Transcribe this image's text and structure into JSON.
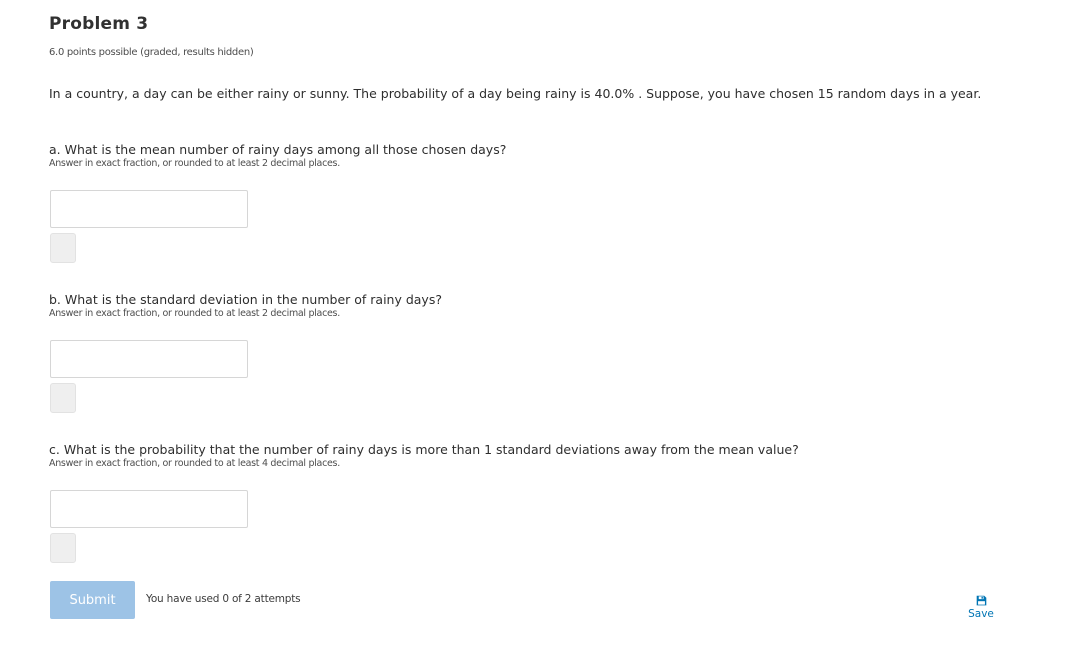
{
  "problem": {
    "title": "Problem 3",
    "points": "6.0 points possible (graded, results hidden)",
    "prompt": "In a country, a day can be either rainy or sunny. The probability of a day being rainy is 40.0% . Suppose, you have chosen 15 random days in a year."
  },
  "questions": [
    {
      "text": "a. What is the mean number of rainy days among all those chosen days?",
      "hint": "Answer in exact fraction, or rounded to at least 2 decimal places.",
      "value": ""
    },
    {
      "text": "b. What is the standard deviation in the number of rainy days?",
      "hint": "Answer in exact fraction, or rounded to at least 2 decimal places.",
      "value": ""
    },
    {
      "text": "c. What is the probability that the number of rainy days is more than 1 standard deviations away from the mean value?",
      "hint": "Answer in exact fraction, or rounded to at least 4 decimal places.",
      "value": ""
    }
  ],
  "actions": {
    "submit_label": "Submit",
    "attempts": "You have used 0 of 2 attempts",
    "save_label": "Save",
    "save_icon": "save-icon"
  },
  "colors": {
    "submit_background": "#9dc3e6",
    "link": "#0075b4"
  }
}
